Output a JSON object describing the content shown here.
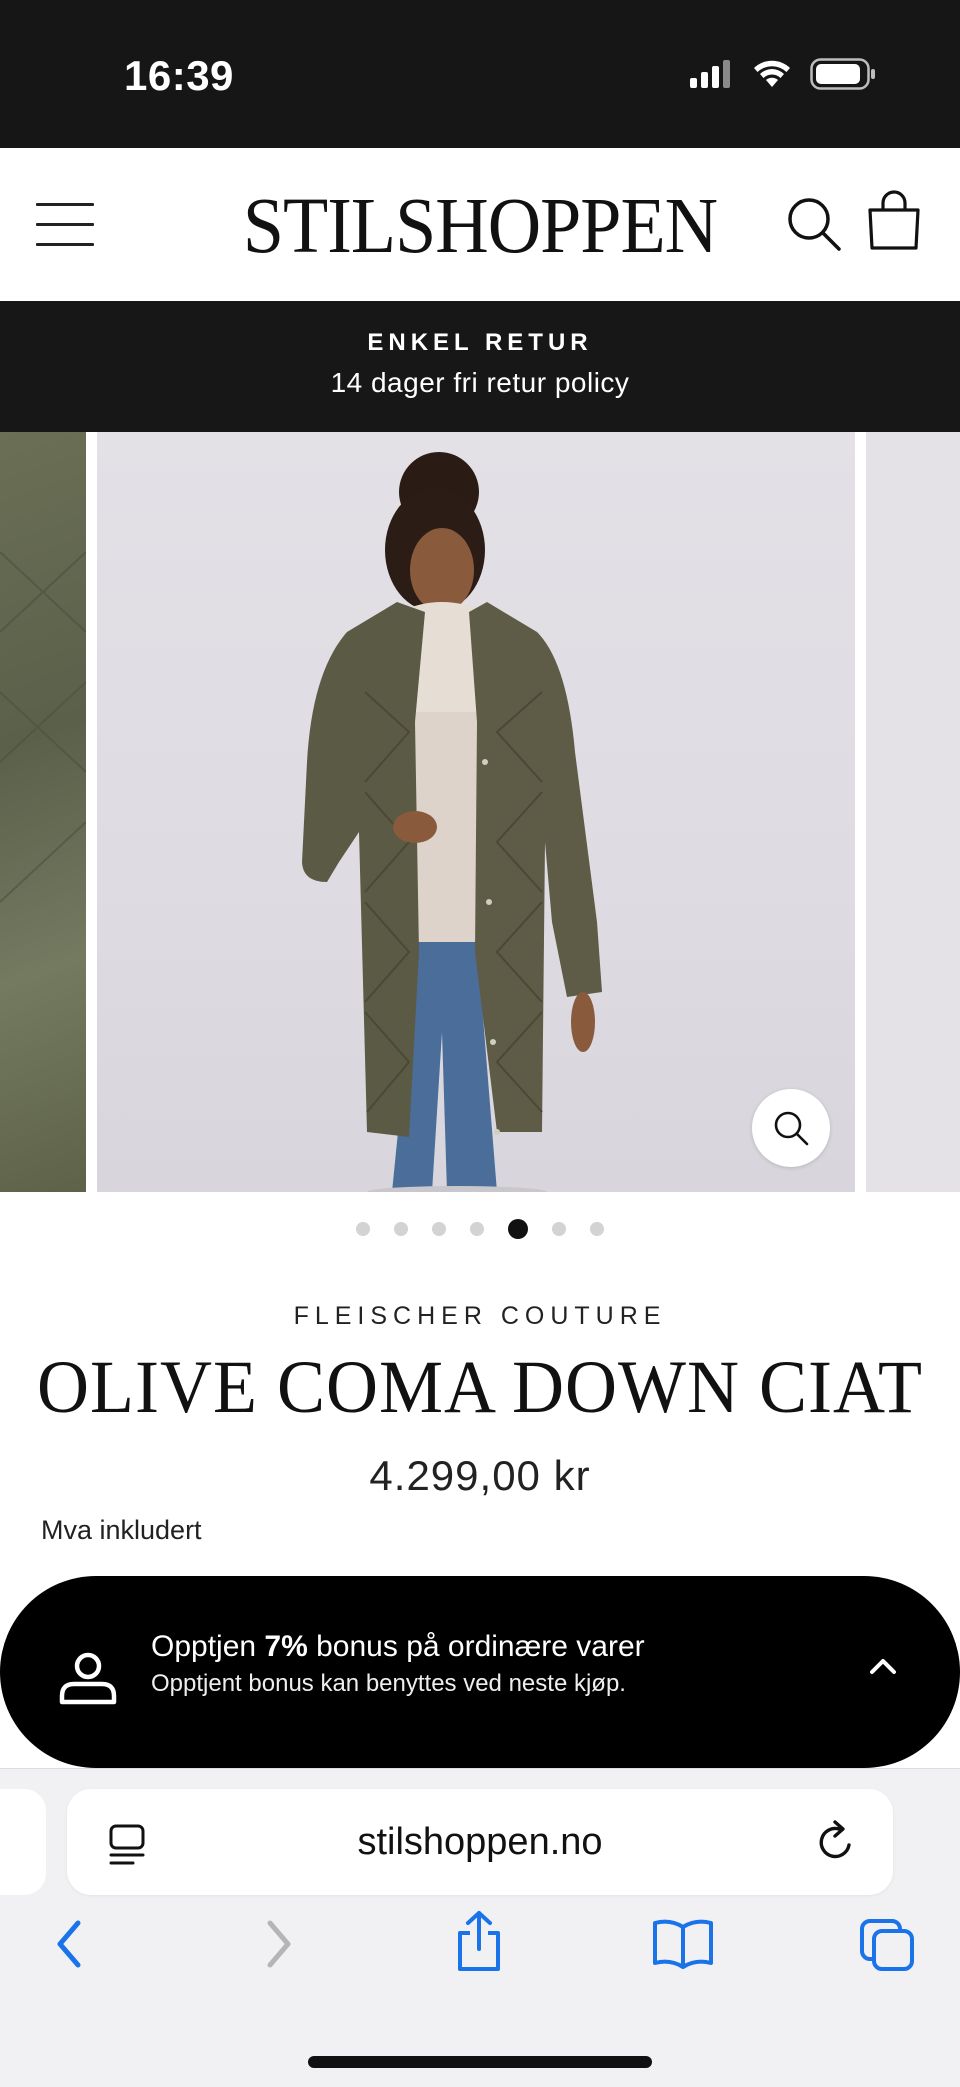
{
  "status_bar": {
    "time": "16:39",
    "icons": [
      "signal-icon",
      "wifi-icon",
      "battery-icon"
    ]
  },
  "header": {
    "logo": "STILSHOPPEN",
    "icons": [
      "menu-icon",
      "search-icon",
      "shopping-bag-icon"
    ]
  },
  "announcement": {
    "title": "ENKEL RETUR",
    "subtitle": "14 dager fri retur policy"
  },
  "gallery": {
    "slide_count": 7,
    "active_index": 4,
    "zoom_icon": "zoom-icon"
  },
  "product": {
    "brand": "FLEISCHER COUTURE",
    "title": "OLIVE COMA DOWN CIAT",
    "price": "4.299,00 kr",
    "vat_note": "Mva inkludert"
  },
  "bonus": {
    "line1_prefix": "Opptjen ",
    "line1_percent": "7%",
    "line1_suffix": " bonus på ordinære varer",
    "line2": "Opptjent bonus kan benyttes ved neste kjøp.",
    "icons": [
      "user-icon",
      "chevron-up-icon"
    ]
  },
  "browser": {
    "url": "stilshoppen.no",
    "accent_color": "#1a73e8",
    "icons": [
      "reader-icon",
      "reload-icon",
      "back-icon",
      "forward-icon",
      "share-icon",
      "bookmarks-icon",
      "tabs-icon"
    ]
  }
}
